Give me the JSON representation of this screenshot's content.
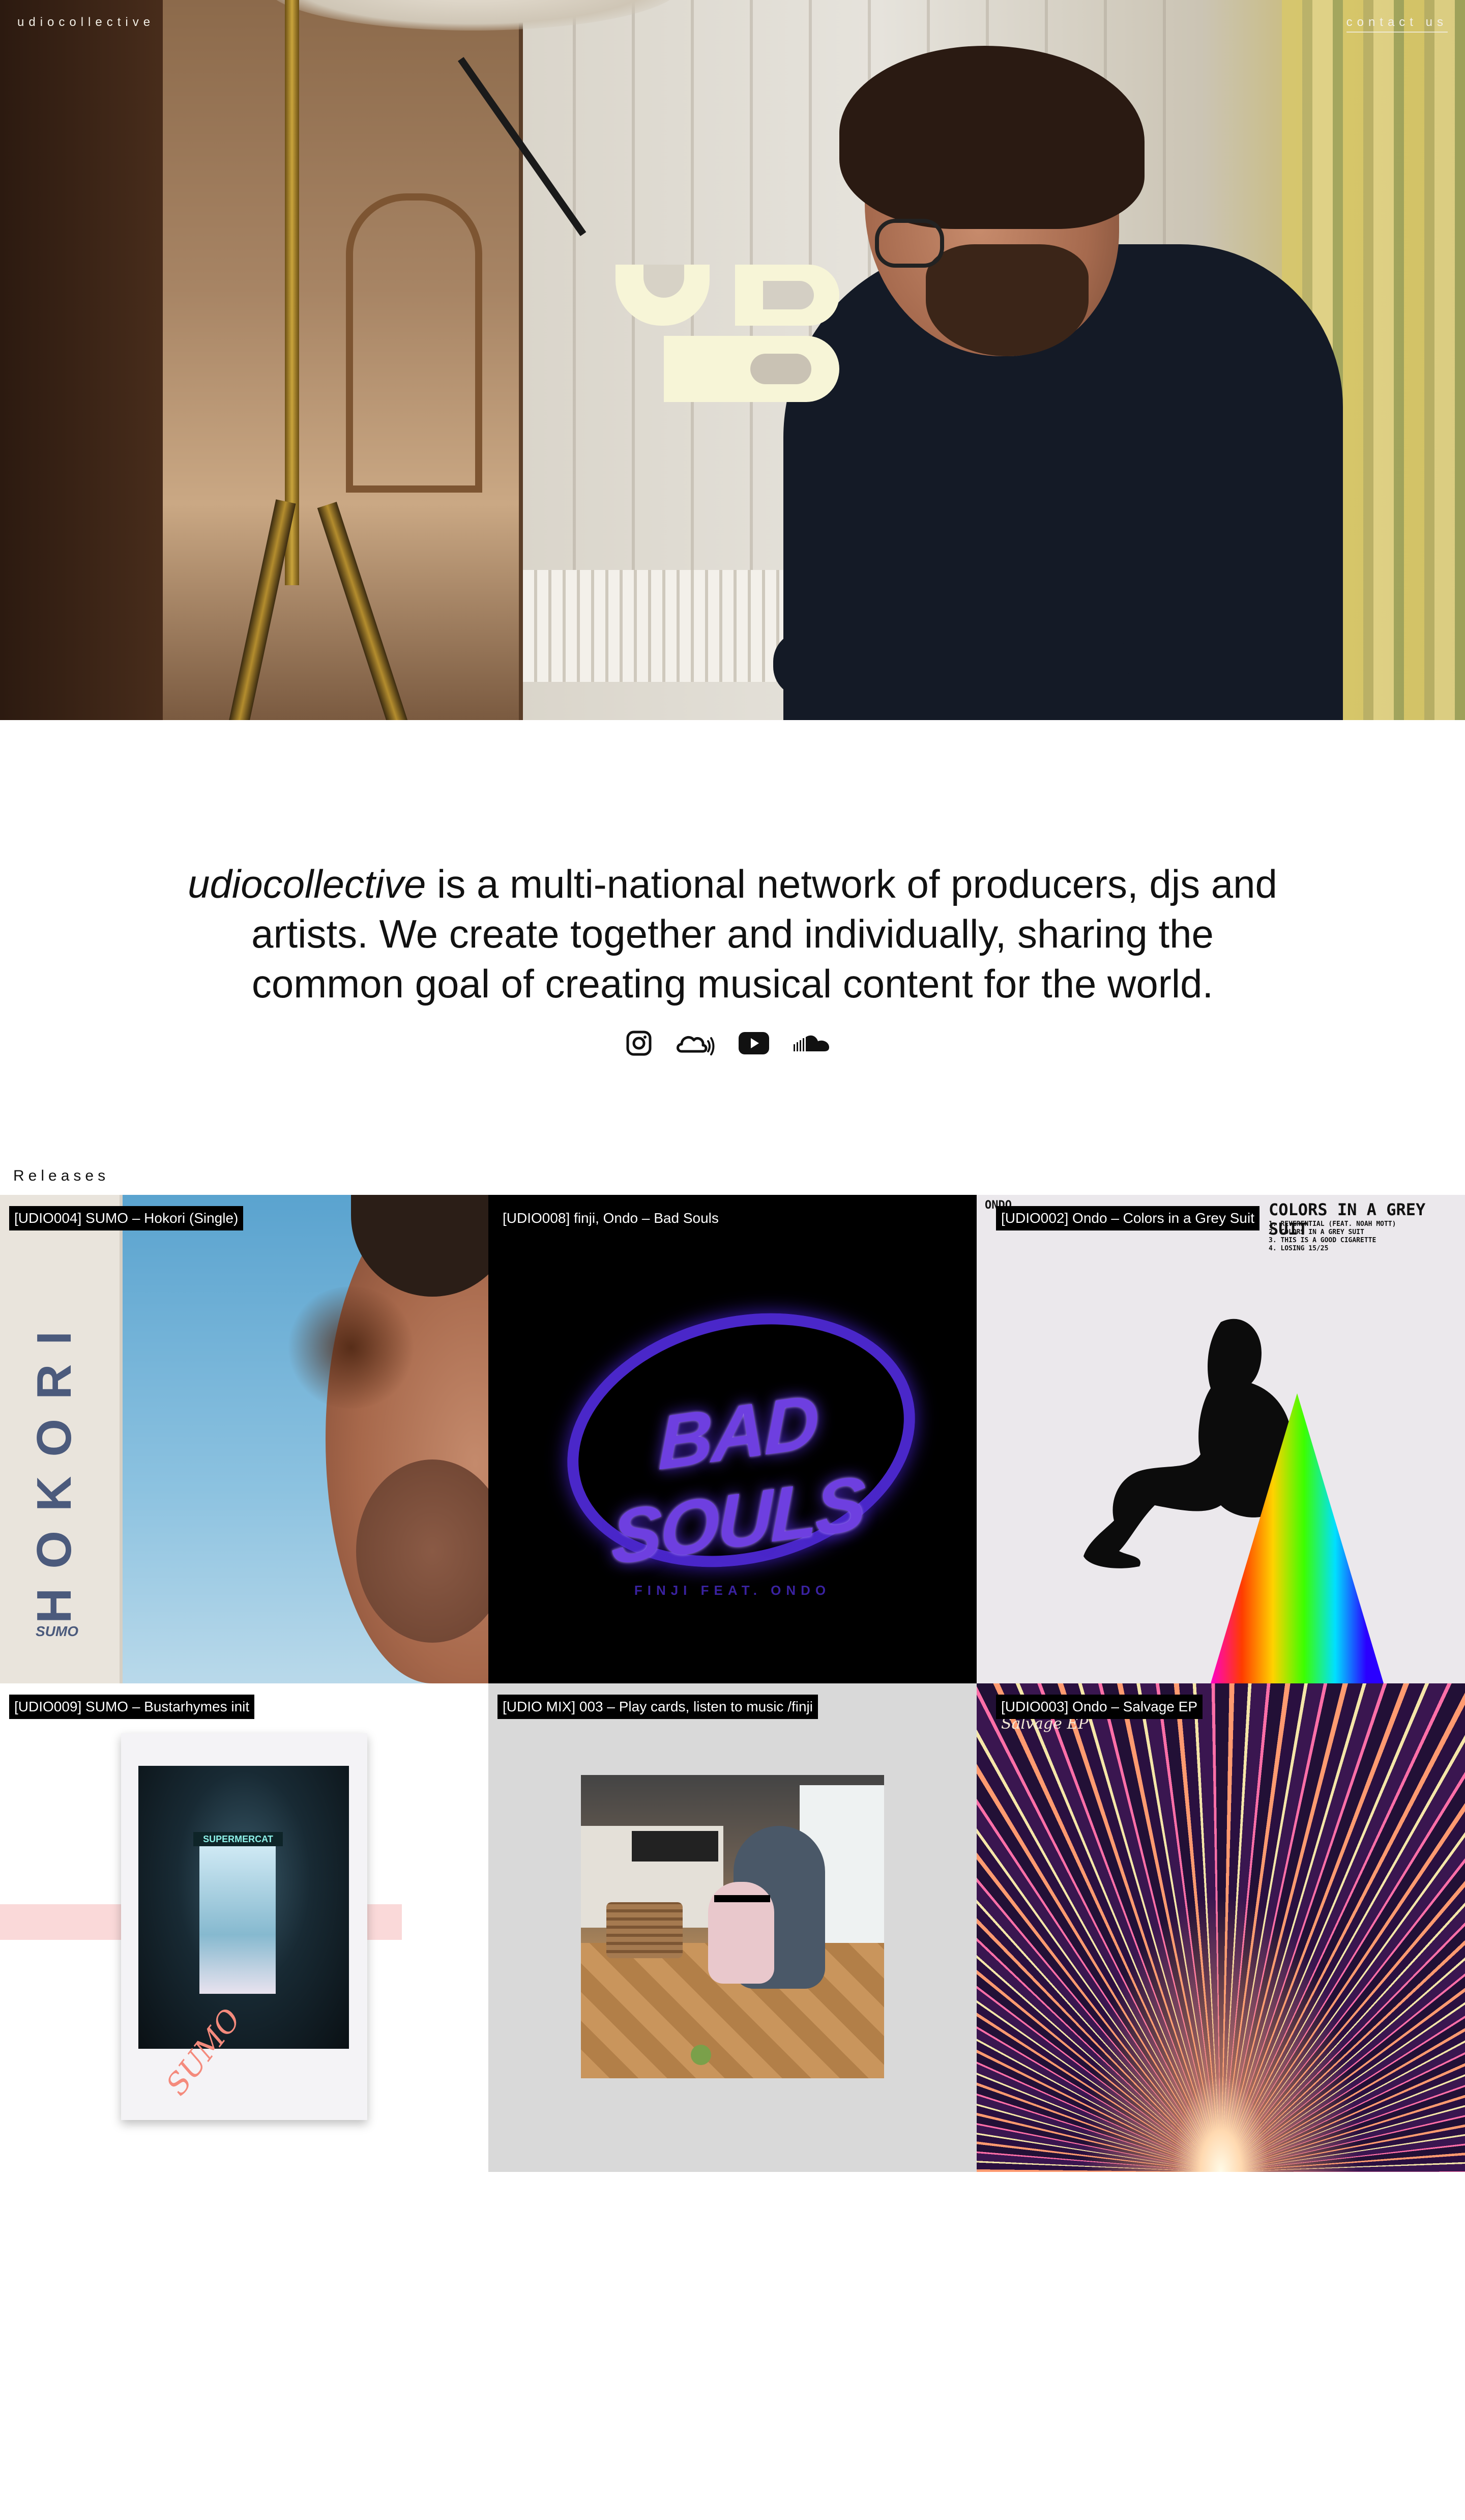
{
  "header": {
    "brand": "udiocollective",
    "contact": "contact us"
  },
  "hero": {
    "logo_alt": "UDIO"
  },
  "intro": {
    "brand_italic": "udiocollective",
    "text": " is a multi-national network of producers, djs and artists. We create together and individually, sharing the common goal of creating musical content for the world."
  },
  "socials": [
    {
      "name": "instagram",
      "icon": "instagram-icon"
    },
    {
      "name": "mixcloud",
      "icon": "mixcloud-icon"
    },
    {
      "name": "youtube",
      "icon": "youtube-icon"
    },
    {
      "name": "soundcloud",
      "icon": "soundcloud-icon"
    }
  ],
  "releases": {
    "heading": "Releases",
    "items": [
      {
        "caption": "[UDIO004] SUMO – Hokori (Single)",
        "art_text": "HOKORI",
        "art_artist": "SUMO"
      },
      {
        "caption": "[UDIO008] finji, Ondo – Bad Souls",
        "art_text": "BAD SOULS",
        "art_sub": "FINJI FEAT. ONDO"
      },
      {
        "caption": "[UDIO002] Ondo – Colors in a Grey Suit",
        "art_title": "COLORS IN A GREY SUIT",
        "art_artist": "ONDO",
        "tracks": [
          "1. REVERENTIAL (FEAT. NOAH MOTT)",
          "2. COLORS IN A GREY SUIT",
          "3. THIS IS A GOOD CIGARETTE",
          "4. LOSING 15/25"
        ]
      },
      {
        "caption": "[UDIO009] SUMO – Bustarhymes init",
        "art_sign": "SUPERMERCAT",
        "art_scribble": "SUMO"
      },
      {
        "caption": "[UDIO MIX] 003 – Play cards, listen to music /finji"
      },
      {
        "caption": "[UDIO003] Ondo – Salvage EP",
        "art_sub": "Salvage EP"
      }
    ]
  }
}
